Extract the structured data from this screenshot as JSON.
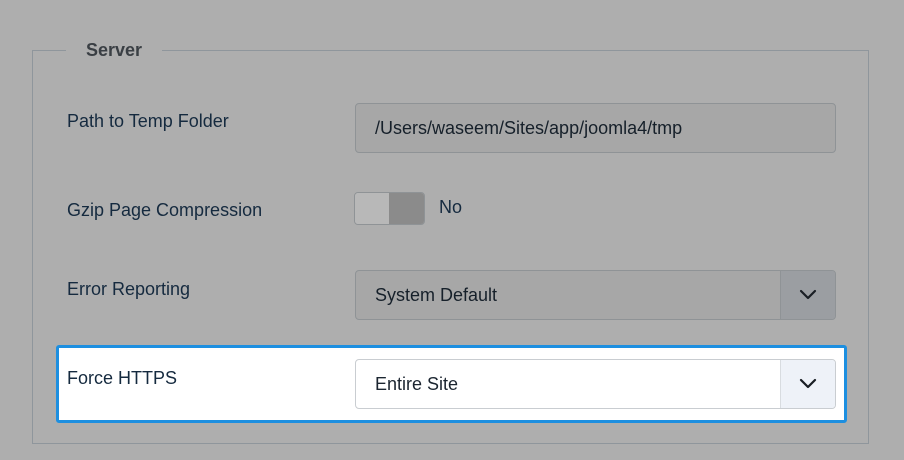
{
  "fieldset": {
    "legend": "Server"
  },
  "fields": {
    "temp_path": {
      "label": "Path to Temp Folder",
      "value": "/Users/waseem/Sites/app/joomla4/tmp"
    },
    "gzip": {
      "label": "Gzip Page Compression",
      "state": "No"
    },
    "error_reporting": {
      "label": "Error Reporting",
      "selected": "System Default"
    },
    "force_https": {
      "label": "Force HTTPS",
      "selected": "Entire Site"
    }
  },
  "colors": {
    "highlight_border": "#1d8fe0",
    "overlay_bg": "#aeaeae"
  },
  "icons": {
    "select_arrow": "chevron-down-icon"
  }
}
